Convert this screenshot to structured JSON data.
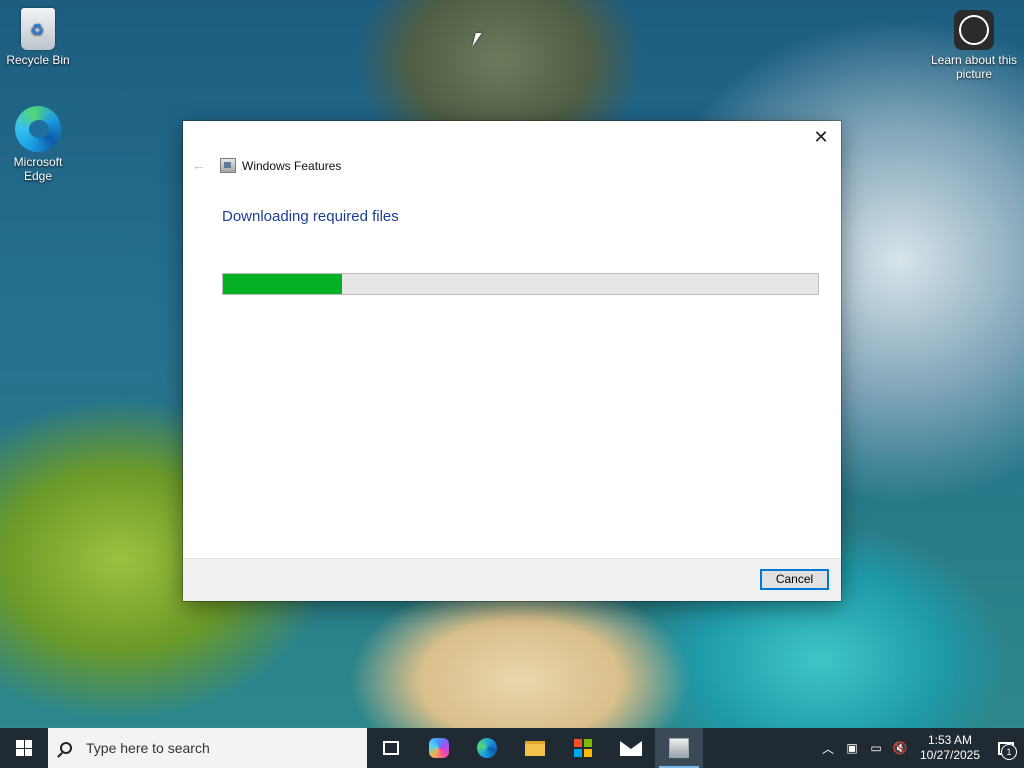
{
  "desktop": {
    "icons": [
      {
        "label": "Recycle Bin",
        "icon": "recycle-bin-icon"
      },
      {
        "label": "Microsoft Edge",
        "icon": "edge-icon"
      },
      {
        "label": "Learn about this picture",
        "icon": "learn-about-picture-icon"
      }
    ]
  },
  "dialog": {
    "title": "Windows Features",
    "back_icon": "back-arrow-icon",
    "close_icon": "close-icon",
    "close_glyph": "✕",
    "back_glyph": "←",
    "heading": "Downloading required files",
    "progress_percent": 20,
    "progress_color": "#06b025",
    "cancel_label": "Cancel"
  },
  "taskbar": {
    "search_placeholder": "Type here to search",
    "pinned": [
      "task-view",
      "copilot",
      "edge",
      "file-explorer",
      "microsoft-store",
      "mail",
      "windows-features"
    ],
    "active": "windows-features",
    "clock_time": "1:53 AM",
    "clock_date": "10/27/2025",
    "notification_count": "1",
    "tray_icons": [
      "chevron-up-icon",
      "meet-now-icon",
      "network-icon",
      "volume-muted-icon"
    ]
  }
}
